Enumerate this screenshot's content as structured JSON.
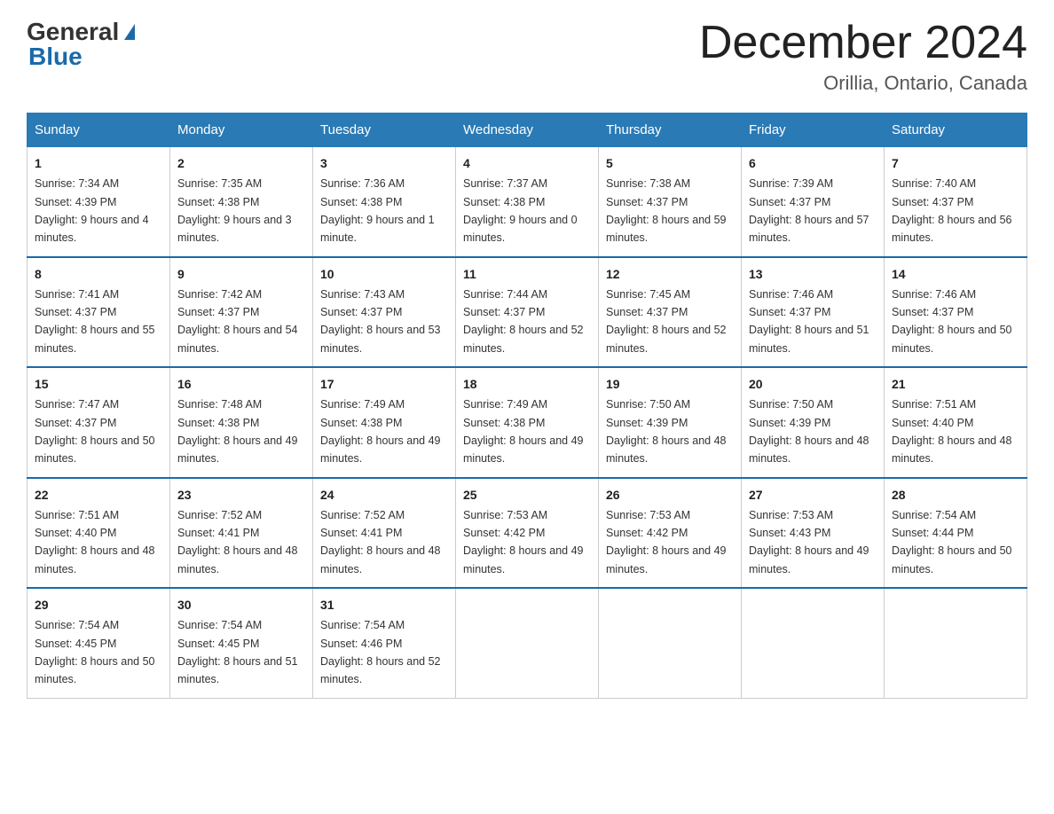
{
  "header": {
    "logo_general": "General",
    "logo_blue": "Blue",
    "month_title": "December 2024",
    "location": "Orillia, Ontario, Canada"
  },
  "days_of_week": [
    "Sunday",
    "Monday",
    "Tuesday",
    "Wednesday",
    "Thursday",
    "Friday",
    "Saturday"
  ],
  "weeks": [
    [
      {
        "day": "1",
        "sunrise": "7:34 AM",
        "sunset": "4:39 PM",
        "daylight": "9 hours and 4 minutes."
      },
      {
        "day": "2",
        "sunrise": "7:35 AM",
        "sunset": "4:38 PM",
        "daylight": "9 hours and 3 minutes."
      },
      {
        "day": "3",
        "sunrise": "7:36 AM",
        "sunset": "4:38 PM",
        "daylight": "9 hours and 1 minute."
      },
      {
        "day": "4",
        "sunrise": "7:37 AM",
        "sunset": "4:38 PM",
        "daylight": "9 hours and 0 minutes."
      },
      {
        "day": "5",
        "sunrise": "7:38 AM",
        "sunset": "4:37 PM",
        "daylight": "8 hours and 59 minutes."
      },
      {
        "day": "6",
        "sunrise": "7:39 AM",
        "sunset": "4:37 PM",
        "daylight": "8 hours and 57 minutes."
      },
      {
        "day": "7",
        "sunrise": "7:40 AM",
        "sunset": "4:37 PM",
        "daylight": "8 hours and 56 minutes."
      }
    ],
    [
      {
        "day": "8",
        "sunrise": "7:41 AM",
        "sunset": "4:37 PM",
        "daylight": "8 hours and 55 minutes."
      },
      {
        "day": "9",
        "sunrise": "7:42 AM",
        "sunset": "4:37 PM",
        "daylight": "8 hours and 54 minutes."
      },
      {
        "day": "10",
        "sunrise": "7:43 AM",
        "sunset": "4:37 PM",
        "daylight": "8 hours and 53 minutes."
      },
      {
        "day": "11",
        "sunrise": "7:44 AM",
        "sunset": "4:37 PM",
        "daylight": "8 hours and 52 minutes."
      },
      {
        "day": "12",
        "sunrise": "7:45 AM",
        "sunset": "4:37 PM",
        "daylight": "8 hours and 52 minutes."
      },
      {
        "day": "13",
        "sunrise": "7:46 AM",
        "sunset": "4:37 PM",
        "daylight": "8 hours and 51 minutes."
      },
      {
        "day": "14",
        "sunrise": "7:46 AM",
        "sunset": "4:37 PM",
        "daylight": "8 hours and 50 minutes."
      }
    ],
    [
      {
        "day": "15",
        "sunrise": "7:47 AM",
        "sunset": "4:37 PM",
        "daylight": "8 hours and 50 minutes."
      },
      {
        "day": "16",
        "sunrise": "7:48 AM",
        "sunset": "4:38 PM",
        "daylight": "8 hours and 49 minutes."
      },
      {
        "day": "17",
        "sunrise": "7:49 AM",
        "sunset": "4:38 PM",
        "daylight": "8 hours and 49 minutes."
      },
      {
        "day": "18",
        "sunrise": "7:49 AM",
        "sunset": "4:38 PM",
        "daylight": "8 hours and 49 minutes."
      },
      {
        "day": "19",
        "sunrise": "7:50 AM",
        "sunset": "4:39 PM",
        "daylight": "8 hours and 48 minutes."
      },
      {
        "day": "20",
        "sunrise": "7:50 AM",
        "sunset": "4:39 PM",
        "daylight": "8 hours and 48 minutes."
      },
      {
        "day": "21",
        "sunrise": "7:51 AM",
        "sunset": "4:40 PM",
        "daylight": "8 hours and 48 minutes."
      }
    ],
    [
      {
        "day": "22",
        "sunrise": "7:51 AM",
        "sunset": "4:40 PM",
        "daylight": "8 hours and 48 minutes."
      },
      {
        "day": "23",
        "sunrise": "7:52 AM",
        "sunset": "4:41 PM",
        "daylight": "8 hours and 48 minutes."
      },
      {
        "day": "24",
        "sunrise": "7:52 AM",
        "sunset": "4:41 PM",
        "daylight": "8 hours and 48 minutes."
      },
      {
        "day": "25",
        "sunrise": "7:53 AM",
        "sunset": "4:42 PM",
        "daylight": "8 hours and 49 minutes."
      },
      {
        "day": "26",
        "sunrise": "7:53 AM",
        "sunset": "4:42 PM",
        "daylight": "8 hours and 49 minutes."
      },
      {
        "day": "27",
        "sunrise": "7:53 AM",
        "sunset": "4:43 PM",
        "daylight": "8 hours and 49 minutes."
      },
      {
        "day": "28",
        "sunrise": "7:54 AM",
        "sunset": "4:44 PM",
        "daylight": "8 hours and 50 minutes."
      }
    ],
    [
      {
        "day": "29",
        "sunrise": "7:54 AM",
        "sunset": "4:45 PM",
        "daylight": "8 hours and 50 minutes."
      },
      {
        "day": "30",
        "sunrise": "7:54 AM",
        "sunset": "4:45 PM",
        "daylight": "8 hours and 51 minutes."
      },
      {
        "day": "31",
        "sunrise": "7:54 AM",
        "sunset": "4:46 PM",
        "daylight": "8 hours and 52 minutes."
      },
      null,
      null,
      null,
      null
    ]
  ]
}
